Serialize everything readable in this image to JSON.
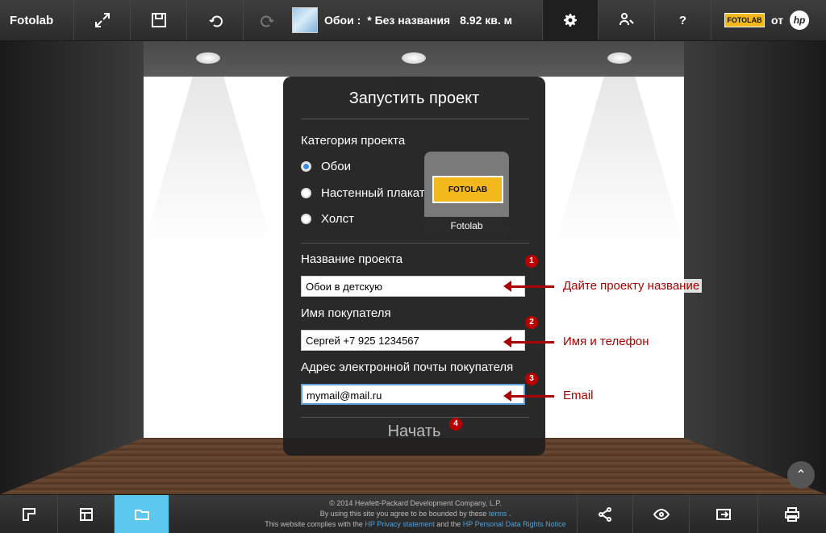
{
  "app": {
    "brand": "Fotolab"
  },
  "topbar": {
    "project_prefix": "Обои :",
    "project_name": "* Без названия",
    "area": "8.92 кв. м",
    "from_label": "от",
    "hp_label": "hp",
    "mini_logo": "FOTOLAB"
  },
  "dialog": {
    "title": "Запустить проект",
    "category_label": "Категория проекта",
    "options": [
      "Обои",
      "Настенный плакат",
      "Холст"
    ],
    "selected_option": "Обои",
    "partner_logo_text": "FOTOLAB",
    "partner_name": "Fotolab",
    "name_label": "Название проекта",
    "name_value": "Обои в детскую",
    "buyer_label": "Имя покупателя",
    "buyer_value": "Сергей +7 925 1234567",
    "email_label": "Адрес электронной почты покупателя",
    "email_value": "mymail@mail.ru",
    "start_label": "Начать"
  },
  "annotations": {
    "badges": [
      "1",
      "2",
      "3",
      "4"
    ],
    "hint_name": "Дайте проекту название",
    "hint_buyer": "Имя и телефон",
    "hint_email": "Email"
  },
  "footer": {
    "line1": "© 2014 Hewlett-Packard Development Company, L.P.",
    "line2_prefix": "By using this site you agree to be bounded by these",
    "terms_link": "terms",
    "line3_prefix": "This website complies with the",
    "privacy_link": "HP Privacy statement",
    "line3_mid": "and the",
    "personal_link": "HP Personal Data Rights Notice"
  },
  "colors": {
    "accent": "#5dc8ee",
    "annotation": "#aa0000",
    "radio": "#3b8be0"
  }
}
